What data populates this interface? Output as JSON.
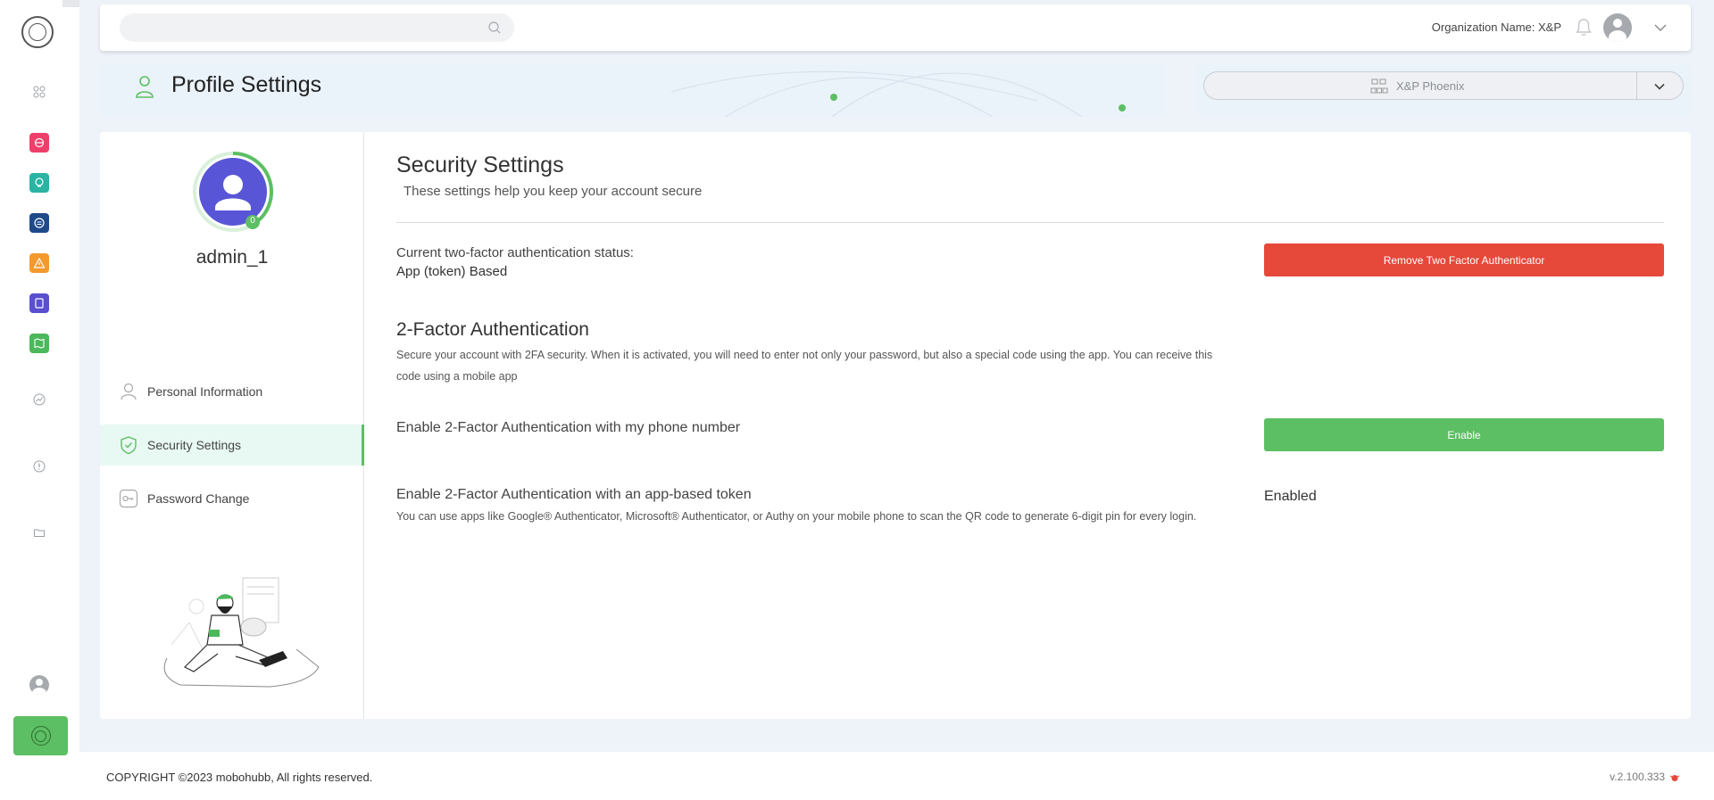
{
  "header": {
    "search_placeholder": "",
    "org_name": "Organization Name: X&P"
  },
  "banner": {
    "title": "Profile Settings"
  },
  "org_select": {
    "label": "X&P Phoenix"
  },
  "profile": {
    "username": "admin_1",
    "badge": "0"
  },
  "nav": {
    "personal": "Personal Information",
    "security": "Security Settings",
    "password": "Password Change"
  },
  "security": {
    "title": "Security Settings",
    "subtitle": "These settings help you keep your account secure",
    "status_label": "Current two-factor authentication status:",
    "status_value": "App (token) Based",
    "remove_button": "Remove Two Factor Authenticator",
    "fa_title": "2-Factor Authentication",
    "fa_desc": "Secure your account with 2FA security. When it is activated, you will need to enter not only your password, but also a special code using the app. You can receive this code using a mobile app",
    "phone_label": "Enable 2-Factor Authentication with my phone number",
    "enable_button": "Enable",
    "app_label": "Enable 2-Factor Authentication with an app-based token",
    "app_desc": "You can use apps like Google® Authenticator, Microsoft® Authenticator, or Authy on your mobile phone to scan the QR code to generate 6-digit pin for every login.",
    "app_status": "Enabled"
  },
  "footer": {
    "copyright": "COPYRIGHT ©2023 mobohubb, All rights reserved.",
    "version": "v.2.100.333"
  },
  "colors": {
    "accent_green": "#5cbf63",
    "danger_red": "#e6483a",
    "avatar_purple": "#5856d6"
  },
  "icons": {
    "sidebar": [
      "logo-icon",
      "grid-icon",
      "pink-app-icon",
      "teal-app-icon",
      "navy-app-icon",
      "orange-warning-icon",
      "purple-app-icon",
      "green-map-icon",
      "chart-icon",
      "alert-icon",
      "folder-icon",
      "user-icon",
      "home-logo-icon"
    ]
  }
}
